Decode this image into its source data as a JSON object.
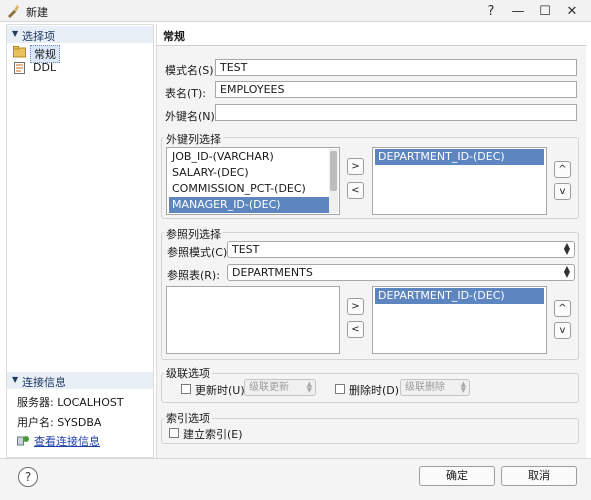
{
  "window": {
    "title": "新建",
    "controls": {
      "help": "?",
      "minimize": "—",
      "maximize": "☐",
      "close": "✕"
    }
  },
  "left": {
    "section1": "选择项",
    "items": [
      {
        "label": "常规",
        "icon": "folder-icon",
        "selected": true
      },
      {
        "label": "DDL",
        "icon": "ddl-file-icon",
        "selected": false
      }
    ],
    "section2": "连接信息",
    "server": "服务器: LOCALHOST",
    "user": "用户名: SYSDBA",
    "link": "查看连接信息"
  },
  "right": {
    "header": "常规",
    "schema_label": "模式名(S):",
    "schema_value": "TEST",
    "table_label": "表名(T):",
    "table_value": "EMPLOYEES",
    "fk_name_label": "外键名(N):",
    "fk_name_value": "",
    "fk_group": "外键列选择",
    "fk_columns": [
      "JOB_ID-(VARCHAR)",
      "SALARY-(DEC)",
      "COMMISSION_PCT-(DEC)",
      "MANAGER_ID-(DEC)"
    ],
    "fk_selected": [
      "DEPARTMENT_ID-(DEC)"
    ],
    "ref_group": "参照列选择",
    "ref_schema_label": "参照模式(C):",
    "ref_schema_value": "TEST",
    "ref_table_label": "参照表(R):",
    "ref_table_value": "DEPARTMENTS",
    "ref_columns": [],
    "ref_selected": [
      "DEPARTMENT_ID-(DEC)"
    ],
    "cascade_group": "级联选项",
    "on_update_label": "更新时(U):",
    "on_update_value": "级联更新",
    "on_delete_label": "删除时(D):",
    "on_delete_value": "级联删除",
    "index_group": "索引选项",
    "build_index_label": "建立索引(E)",
    "arrows": {
      "add": ">",
      "remove": "<",
      "up": "^",
      "down": "v"
    }
  },
  "footer": {
    "ok": "确定",
    "cancel": "取消"
  }
}
